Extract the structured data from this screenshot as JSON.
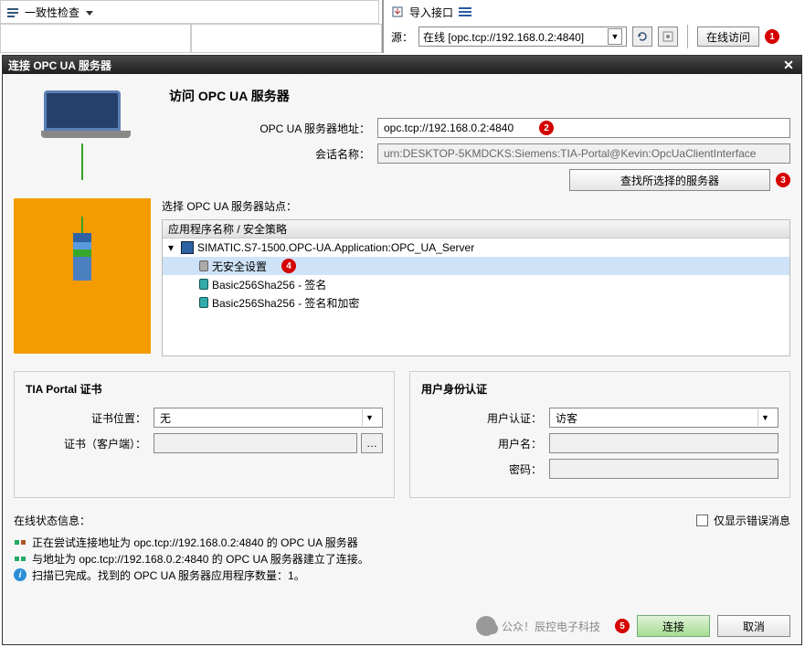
{
  "topbar": {
    "consistency_check": "一致性检查",
    "import_interface": "导入接口",
    "source_label": "源：",
    "source_value": "在线 [opc.tcp://192.168.0.2:4840]",
    "online_access": "在线访问"
  },
  "dialog": {
    "title": "连接 OPC UA 服务器",
    "access_title": "访问 OPC UA 服务器",
    "server_addr_label": "OPC UA 服务器地址：",
    "server_addr_value": "opc.tcp://192.168.0.2:4840",
    "session_label": "会话名称：",
    "session_value": "urn:DESKTOP-5KMDCKS:Siemens:TIA-Portal@Kevin:OpcUaClientInterface",
    "find_button": "查找所选择的服务器",
    "site_label": "选择 OPC UA 服务器站点：",
    "tree_header": "应用程序名称 / 安全策略",
    "tree_root": "SIMATIC.S7-1500.OPC-UA.Application:OPC_UA_Server",
    "tree_items": [
      "无安全设置",
      "Basic256Sha256 - 签名",
      "Basic256Sha256 - 签名和加密"
    ],
    "tia_group": "TIA Portal 证书",
    "cert_location_label": "证书位置：",
    "cert_location_value": "无",
    "cert_client_label": "证书（客户端）：",
    "auth_group": "用户身份认证",
    "user_auth_label": "用户认证：",
    "user_auth_value": "访客",
    "username_label": "用户名：",
    "password_label": "密码：",
    "status_title": "在线状态信息：",
    "errors_only": "仅显示错误消息",
    "status_lines": [
      "正在尝试连接地址为 opc.tcp://192.168.0.2:4840 的 OPC UA 服务器",
      "与地址为 opc.tcp://192.168.0.2:4840 的 OPC UA 服务器建立了连接。",
      "扫描已完成。找到的 OPC UA 服务器应用程序数量：1。"
    ],
    "connect": "连接",
    "cancel": "取消",
    "watermark": "公众！辰控电子科技"
  },
  "badges": {
    "b1": "1",
    "b2": "2",
    "b3": "3",
    "b4": "4",
    "b5": "5"
  }
}
